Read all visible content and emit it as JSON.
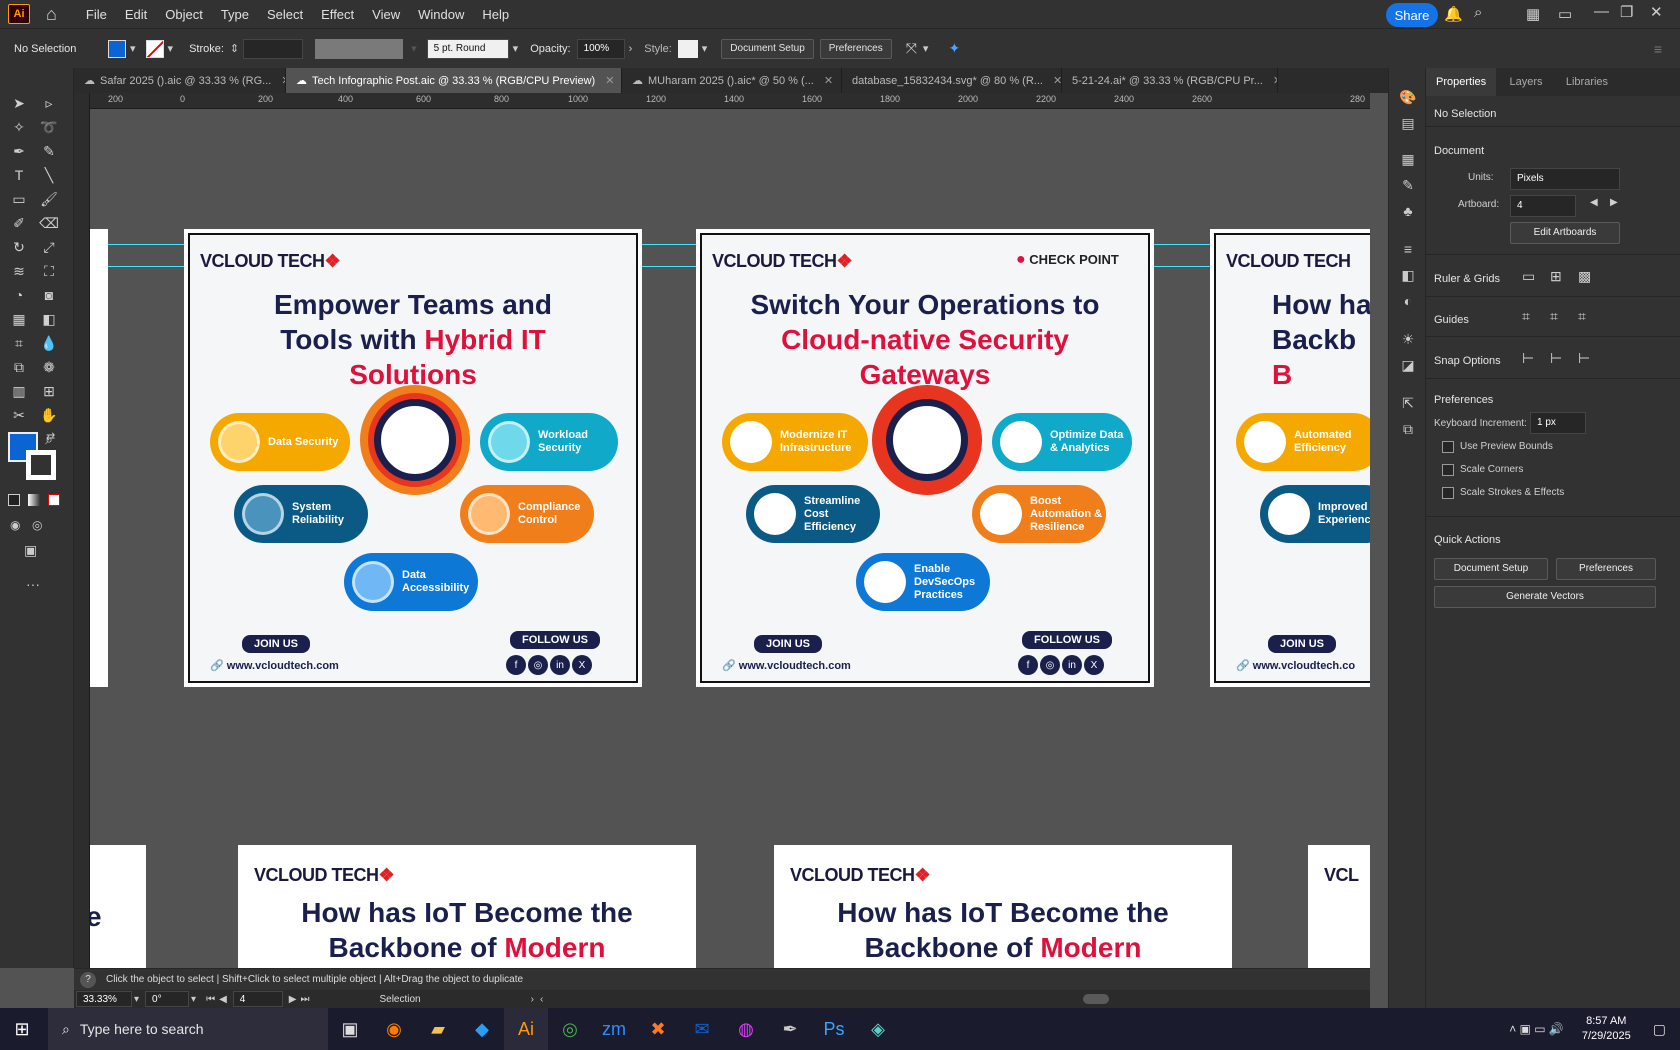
{
  "app": {
    "logo": "Ai",
    "home_icon": "home-icon"
  },
  "menu": [
    "File",
    "Edit",
    "Object",
    "Type",
    "Select",
    "Effect",
    "View",
    "Window",
    "Help"
  ],
  "top_right": {
    "share": "Share"
  },
  "control_bar": {
    "selection": "No Selection",
    "stroke_label": "Stroke:",
    "brush": "5 pt. Round",
    "opacity_label": "Opacity:",
    "opacity_value": "100%",
    "style_label": "Style:",
    "document_setup": "Document Setup",
    "preferences": "Preferences"
  },
  "tabs": [
    {
      "label": "Safar 2025 ().aic @ 33.33 % (RG...",
      "active": false
    },
    {
      "label": "Tech Infographic Post.aic @ 33.33 % (RGB/CPU Preview)",
      "active": true
    },
    {
      "label": "MUharam 2025 ().aic* @ 50 % (...",
      "active": false
    },
    {
      "label": "database_15832434.svg* @ 80 % (R...",
      "active": false
    },
    {
      "label": "5-21-24.ai* @ 33.33 % (RGB/CPU Pr...",
      "active": false
    }
  ],
  "ruler_h": [
    "200",
    "0",
    "200",
    "400",
    "600",
    "800",
    "1000",
    "1200",
    "1400",
    "1600",
    "1800",
    "2000",
    "2200",
    "2400",
    "2600",
    "280"
  ],
  "artboard1": {
    "brand": "VCLOUD TECH",
    "headline_line1": "Empower Teams and",
    "headline_line2a": "Tools with ",
    "headline_line2b": "Hybrid IT",
    "headline_line3": "Solutions",
    "pills": [
      "Data Security",
      "Workload Security",
      "System Reliability",
      "Compliance Control",
      "Data Accessibility"
    ],
    "join": "JOIN US",
    "follow": "FOLLOW US",
    "site": "www.vcloudtech.com"
  },
  "artboard2": {
    "brand": "VCLOUD TECH",
    "partner": "CHECK POINT",
    "headline_line1": "Switch Your Operations to",
    "headline_line2": "Cloud-native Security",
    "headline_line3": "Gateways",
    "pills": [
      "Modernize IT Infrastructure",
      "Optimize Data & Analytics",
      "Streamline Cost Efficiency",
      "Boost Automation & Resilience",
      "Enable DevSecOps Practices"
    ],
    "join": "JOIN US",
    "follow": "FOLLOW US",
    "site": "www.vcloudtech.com"
  },
  "artboard3": {
    "brand": "VCLOUD TECH",
    "headline_line1": "How ha",
    "headline_line2": "Backb",
    "headline_line3": "B",
    "pills": [
      "Automated Efficiency",
      "Improved Experienc"
    ],
    "join": "JOIN US",
    "site": "www.vcloudtech.co"
  },
  "artboard_bottom": {
    "brand": "VCLOUD TECH",
    "headline_line1": "How has IoT Become the",
    "headline_line2a": "Backbone of ",
    "headline_line2b": "Modern",
    "left_fragment": "e",
    "right_brand_fragment": "VCL"
  },
  "status": {
    "hint": "Click the object to select  |  Shift+Click to select multiple object  |  Alt+Drag the object to duplicate",
    "zoom": "33.33%",
    "rotation": "0°",
    "artboard_num": "4",
    "tool": "Selection"
  },
  "properties": {
    "tabs": [
      "Properties",
      "Layers",
      "Libraries"
    ],
    "selection": "No Selection",
    "document": "Document",
    "units_label": "Units:",
    "units_value": "Pixels",
    "artboard_label": "Artboard:",
    "artboard_value": "4",
    "edit_artboards": "Edit Artboards",
    "ruler_grids": "Ruler & Grids",
    "guides": "Guides",
    "snap_options": "Snap Options",
    "preferences": "Preferences",
    "keyboard_increment_label": "Keyboard Increment:",
    "keyboard_increment_value": "1 px",
    "use_preview_bounds": "Use Preview Bounds",
    "scale_corners": "Scale Corners",
    "scale_strokes": "Scale Strokes & Effects",
    "quick_actions": "Quick Actions",
    "document_setup": "Document Setup",
    "preferences_btn": "Preferences",
    "generate_vectors": "Generate Vectors"
  },
  "taskbar": {
    "search_placeholder": "Type here to search",
    "time": "8:57 AM",
    "date": "7/29/2025"
  },
  "colors": {
    "accent": "#1473e6",
    "fill": "#0a64d4",
    "guide": "#3ee5ff"
  }
}
